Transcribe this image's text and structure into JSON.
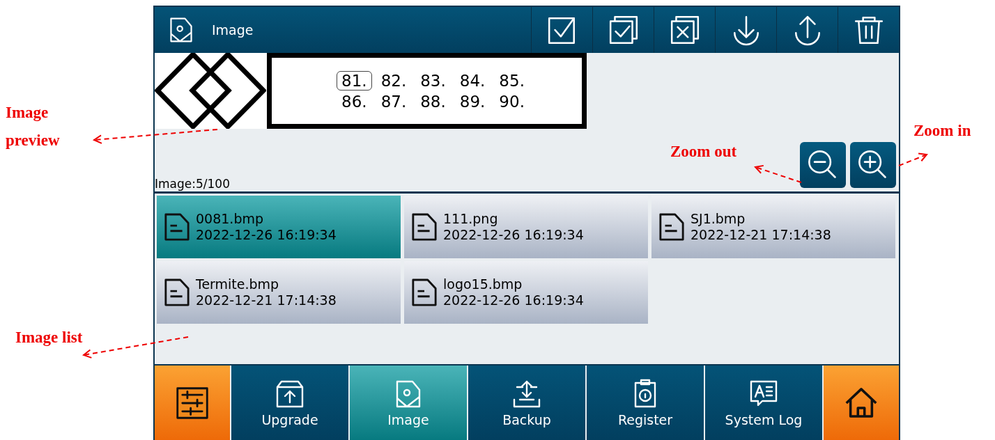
{
  "header": {
    "title": "Image",
    "toolbar": [
      {
        "kind": "check"
      },
      {
        "kind": "check-all"
      },
      {
        "kind": "uncheck-all"
      },
      {
        "kind": "download"
      },
      {
        "kind": "upload"
      },
      {
        "kind": "delete"
      }
    ]
  },
  "preview": {
    "rows": [
      [
        {
          "text": "81.",
          "selected": true
        },
        {
          "text": "82.",
          "selected": false
        },
        {
          "text": "83.",
          "selected": false
        },
        {
          "text": "84.",
          "selected": false
        },
        {
          "text": "85.",
          "selected": false
        }
      ],
      [
        {
          "text": "86.",
          "selected": false
        },
        {
          "text": "87.",
          "selected": false
        },
        {
          "text": "88.",
          "selected": false
        },
        {
          "text": "89.",
          "selected": false
        },
        {
          "text": "90.",
          "selected": false
        }
      ]
    ],
    "count": "Image:5/100",
    "zoom_buttons": [
      {
        "kind": "zoom-out"
      },
      {
        "kind": "zoom-in"
      }
    ]
  },
  "files": [
    {
      "name": "0081.bmp",
      "date": "2022-12-26 16:19:34",
      "selected": true
    },
    {
      "name": "111.png",
      "date": "2022-12-26 16:19:34",
      "selected": false
    },
    {
      "name": "SJ1.bmp",
      "date": "2022-12-21 17:14:38",
      "selected": false
    },
    {
      "name": "Termite.bmp",
      "date": "2022-12-21 17:14:38",
      "selected": false
    },
    {
      "name": "logo15.bmp",
      "date": "2022-12-26 16:19:34",
      "selected": false
    }
  ],
  "nav": [
    {
      "kind": "settings",
      "selected": false
    },
    {
      "kind": "upgrade",
      "label": "Upgrade",
      "selected": false
    },
    {
      "kind": "image",
      "label": "Image",
      "selected": true
    },
    {
      "kind": "backup",
      "label": "Backup",
      "selected": false
    },
    {
      "kind": "register",
      "label": "Register",
      "selected": false
    },
    {
      "kind": "log",
      "label": "System Log",
      "selected": false
    },
    {
      "kind": "home",
      "selected": false
    }
  ],
  "annotations": [
    {
      "text": "Image preview"
    },
    {
      "text": "Zoom out"
    },
    {
      "text": "Zoom in"
    },
    {
      "text": "Image list"
    }
  ]
}
